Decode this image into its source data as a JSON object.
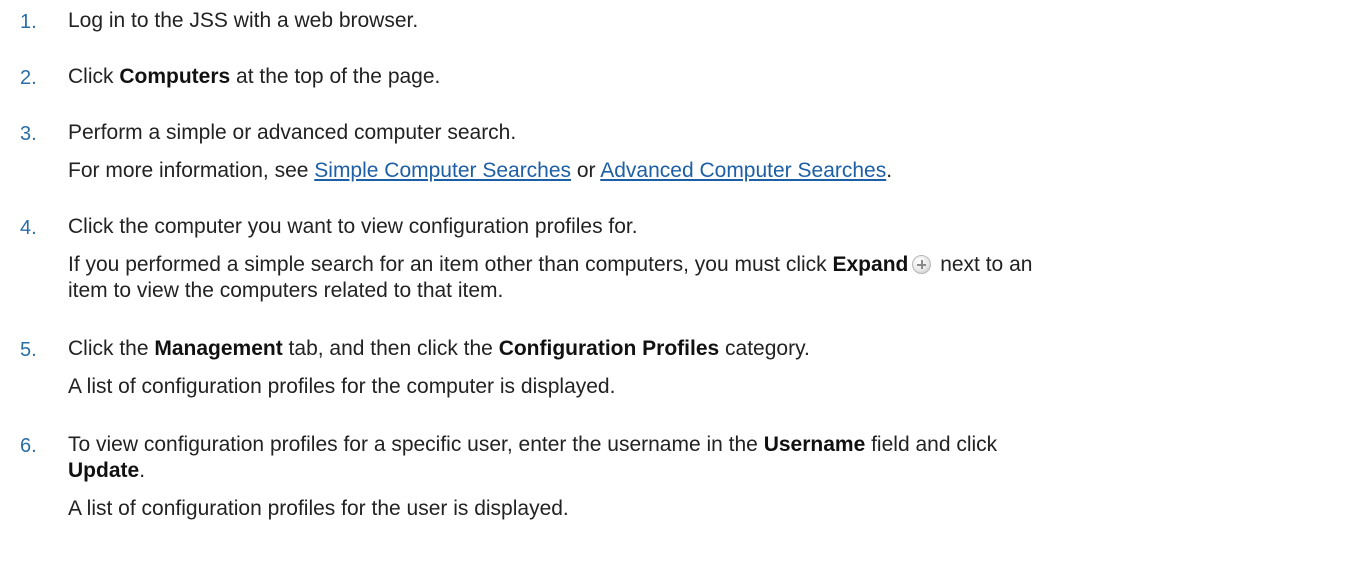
{
  "steps": [
    {
      "number": "1.",
      "lines": [
        {
          "text": "Log in to the JSS with a web browser."
        }
      ]
    },
    {
      "number": "2.",
      "lines": [
        {
          "pre": "Click ",
          "bold": "Computers",
          "post": " at the top of the page."
        }
      ]
    },
    {
      "number": "3.",
      "lines": [
        {
          "text": "Perform a simple or advanced computer search."
        },
        {
          "pre": "For more information, see ",
          "link1": "Simple Computer Searches",
          "mid": " or ",
          "link2": "Advanced Computer Searches",
          "post": "."
        }
      ]
    },
    {
      "number": "4.",
      "lines": [
        {
          "text": "Click the computer you want to view configuration profiles for."
        },
        {
          "pre": "If you performed a simple search for an item other than computers, you must click ",
          "bold": "Expand",
          "post": " next to an"
        },
        {
          "text": "item to view the computers related to that item."
        }
      ]
    },
    {
      "number": "5.",
      "lines": [
        {
          "pre": "Click the ",
          "bold1": "Management",
          "mid": " tab, and then click the ",
          "bold2": "Configuration Profiles",
          "post": " category."
        },
        {
          "text": "A list of configuration profiles for the computer is displayed."
        }
      ]
    },
    {
      "number": "6.",
      "lines": [
        {
          "pre": "To view configuration profiles for a specific user, enter the username in the ",
          "bold1": "Username",
          "post": " field and click"
        },
        {
          "bold": "Update",
          "post": "."
        },
        {
          "text": "A list of configuration profiles for the user is displayed."
        }
      ]
    }
  ]
}
